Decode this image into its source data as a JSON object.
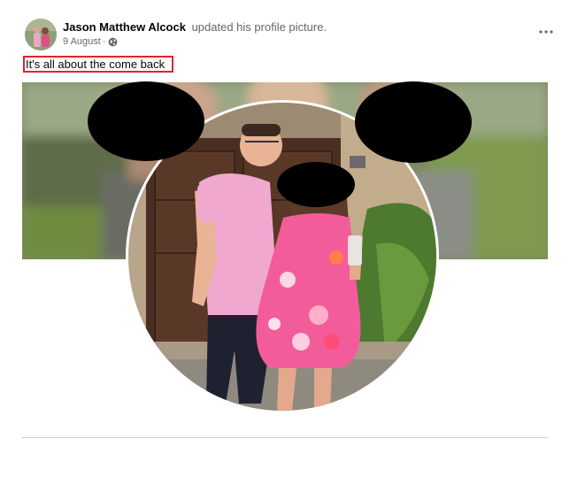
{
  "post": {
    "author_name": "Jason Matthew Alcock",
    "action_text": "updated his profile picture.",
    "date": "9 August",
    "separator": "·",
    "privacy_icon": "globe-icon",
    "more_icon": "more-options-icon",
    "caption": "It's all about the come back"
  },
  "colors": {
    "highlight_border": "#e2232c",
    "text_primary": "#050505",
    "text_secondary": "#65676b",
    "redaction": "#000000"
  }
}
